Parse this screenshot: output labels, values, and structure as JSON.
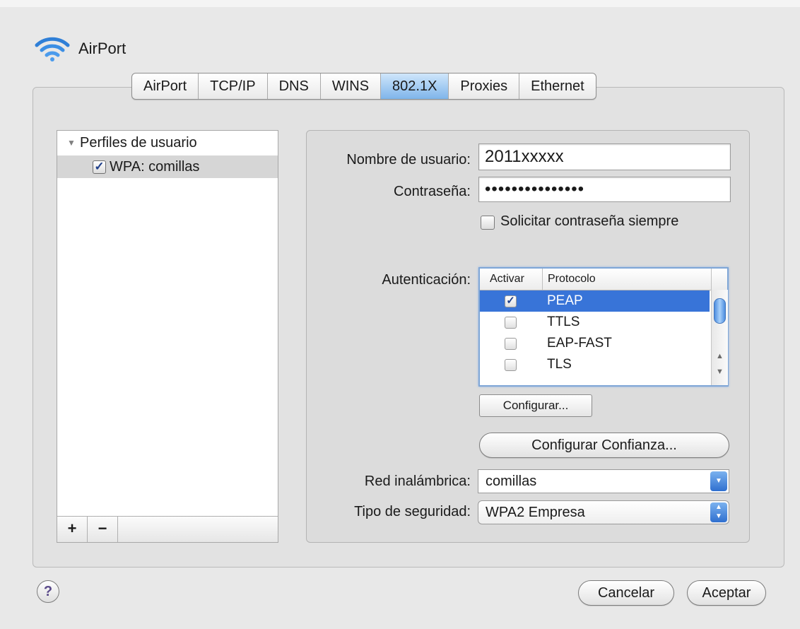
{
  "window": {
    "title": "AirPort"
  },
  "tabs": [
    {
      "label": "AirPort",
      "active": false
    },
    {
      "label": "TCP/IP",
      "active": false
    },
    {
      "label": "DNS",
      "active": false
    },
    {
      "label": "WINS",
      "active": false
    },
    {
      "label": "802.1X",
      "active": true
    },
    {
      "label": "Proxies",
      "active": false
    },
    {
      "label": "Ethernet",
      "active": false
    }
  ],
  "profiles": {
    "header": "Perfiles de usuario",
    "items": [
      {
        "label": "WPA: comillas",
        "checked": true
      }
    ],
    "add_label": "+",
    "remove_label": "−"
  },
  "form": {
    "username_label": "Nombre de usuario:",
    "username_value": "2011xxxxx",
    "password_label": "Contraseña:",
    "password_value": "•••••••••••••••",
    "ask_password_label": "Solicitar contraseña siempre",
    "ask_password_checked": false,
    "auth_label": "Autenticación:",
    "auth_table": {
      "col_enable": "Activar",
      "col_protocol": "Protocolo",
      "rows": [
        {
          "protocol": "PEAP",
          "enabled": true,
          "selected": true
        },
        {
          "protocol": "TTLS",
          "enabled": false,
          "selected": false
        },
        {
          "protocol": "EAP-FAST",
          "enabled": false,
          "selected": false
        },
        {
          "protocol": "TLS",
          "enabled": false,
          "selected": false
        }
      ]
    },
    "configure_button": "Configurar...",
    "trust_button": "Configurar Confianza...",
    "wireless_label": "Red inalámbrica:",
    "wireless_value": "comillas",
    "security_label": "Tipo de seguridad:",
    "security_value": "WPA2 Empresa"
  },
  "footer": {
    "help_label": "?",
    "cancel_button": "Cancelar",
    "ok_button": "Aceptar"
  },
  "colors": {
    "selection": "#3874d8",
    "active_tab": "#7fb5ea",
    "window_bg": "#e8e8e8"
  }
}
